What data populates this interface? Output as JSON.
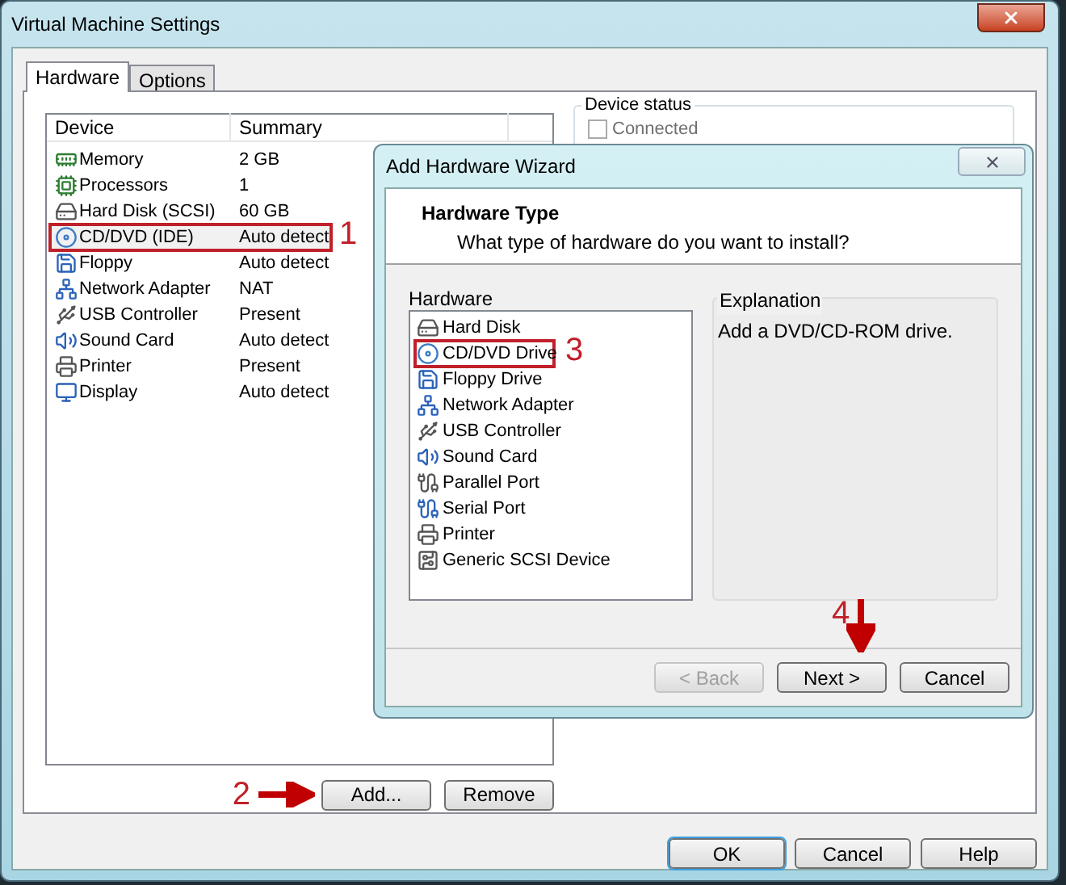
{
  "window": {
    "title": "Virtual Machine Settings"
  },
  "tabs": [
    {
      "label": "Hardware",
      "selected": true
    },
    {
      "label": "Options",
      "selected": false
    }
  ],
  "device_table": {
    "columns": [
      "Device",
      "Summary"
    ],
    "rows": [
      {
        "device": "Memory",
        "summary": "2 GB",
        "kind": "memory",
        "marked": false
      },
      {
        "device": "Processors",
        "summary": "1",
        "kind": "cpu",
        "marked": false
      },
      {
        "device": "Hard Disk (SCSI)",
        "summary": "60 GB",
        "kind": "disk",
        "marked": false
      },
      {
        "device": "CD/DVD (IDE)",
        "summary": "Auto detect",
        "kind": "cd",
        "marked": true,
        "callout": {
          "number": "1"
        }
      },
      {
        "device": "Floppy",
        "summary": "Auto detect",
        "kind": "floppy",
        "marked": false
      },
      {
        "device": "Network Adapter",
        "summary": "NAT",
        "kind": "network",
        "marked": false
      },
      {
        "device": "USB Controller",
        "summary": "Present",
        "kind": "usb",
        "marked": false
      },
      {
        "device": "Sound Card",
        "summary": "Auto detect",
        "kind": "sound",
        "marked": false
      },
      {
        "device": "Printer",
        "summary": "Present",
        "kind": "printer",
        "marked": false
      },
      {
        "device": "Display",
        "summary": "Auto detect",
        "kind": "display",
        "marked": false
      }
    ]
  },
  "list_buttons": [
    {
      "label": "Add...",
      "callout": {
        "number": "2",
        "kind": "arrow_right"
      }
    },
    {
      "label": "Remove"
    }
  ],
  "device_status": {
    "title": "Device status",
    "checkboxes": [
      {
        "label": "Connected",
        "checked": false
      }
    ]
  },
  "dialog_buttons": [
    {
      "label": "OK",
      "default": true
    },
    {
      "label": "Cancel",
      "default": false
    },
    {
      "label": "Help",
      "default": false
    }
  ],
  "wizard": {
    "title": "Add Hardware Wizard",
    "heading": "Hardware Type",
    "subheading": "What type of hardware do you want to install?",
    "list_label": "Hardware",
    "items": [
      {
        "label": "Hard Disk",
        "kind": "disk",
        "marked": false
      },
      {
        "label": "CD/DVD Drive",
        "kind": "cd",
        "marked": true,
        "callout": {
          "number": "3"
        }
      },
      {
        "label": "Floppy Drive",
        "kind": "floppy",
        "marked": false
      },
      {
        "label": "Network Adapter",
        "kind": "network",
        "marked": false
      },
      {
        "label": "USB Controller",
        "kind": "usb",
        "marked": false
      },
      {
        "label": "Sound Card",
        "kind": "sound",
        "marked": false
      },
      {
        "label": "Parallel Port",
        "kind": "parallel",
        "marked": false
      },
      {
        "label": "Serial Port",
        "kind": "serial",
        "marked": false
      },
      {
        "label": "Printer",
        "kind": "printer",
        "marked": false
      },
      {
        "label": "Generic SCSI Device",
        "kind": "scsi",
        "marked": false
      }
    ],
    "explanation": {
      "title": "Explanation",
      "text": "Add a DVD/CD-ROM drive."
    },
    "buttons": [
      {
        "label": "< Back",
        "disabled": true
      },
      {
        "label": "Next >",
        "disabled": false,
        "callout": {
          "number": "4",
          "kind": "arrow_down"
        }
      },
      {
        "label": "Cancel",
        "disabled": false
      }
    ]
  }
}
